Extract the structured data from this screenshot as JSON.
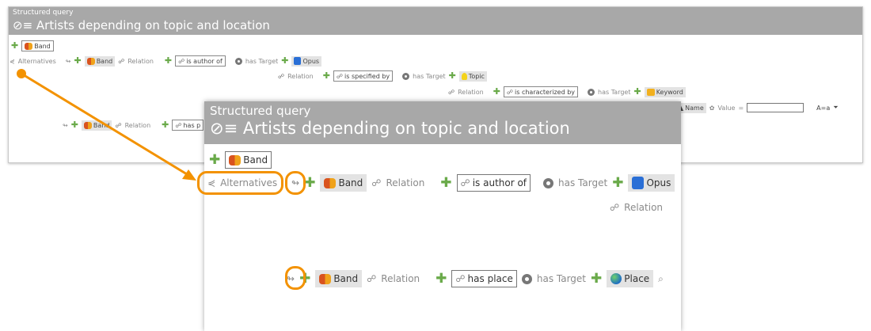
{
  "small": {
    "caption": "Structured query",
    "title": "Artists depending on topic and location",
    "root_label": "Band",
    "alternatives_label": "Alternatives",
    "band_label": "Band",
    "relation_label": "Relation",
    "is_author_of": "is author of",
    "has_target": "has Target",
    "opus_label": "Opus",
    "is_specified_by": "is specified by",
    "topic_label": "Topic",
    "is_characterized_by": "is characterized by",
    "keyword_label": "Keyword",
    "name_label": "Name",
    "value_label": "Value",
    "equals": "=",
    "match_label": "A=a",
    "band2_label": "Band",
    "relation2_label": "Relation",
    "has_place_trunc": "has p"
  },
  "big": {
    "caption": "Structured query",
    "title": "Artists depending on topic and location",
    "root_label": "Band",
    "alternatives_label": "Alternatives",
    "band_label": "Band",
    "relation_label": "Relation",
    "is_author_of": "is author of",
    "has_target": "has Target",
    "opus_label": "Opus",
    "relation_sub_label": "Relation",
    "band2_label": "Band",
    "relation2_label": "Relation",
    "has_place": "has place",
    "has_target2": "has Target",
    "place_label": "Place"
  },
  "colors": {
    "accent": "#f39200",
    "header": "#a8a8a8",
    "plus": "#6aaa4a"
  },
  "icons": [
    "plus-icon",
    "band-icon",
    "opus-icon",
    "topic-icon",
    "keyword-icon",
    "place-icon",
    "target-icon",
    "relation-icon",
    "search-icon",
    "alternatives-icon",
    "arrow-icon"
  ]
}
